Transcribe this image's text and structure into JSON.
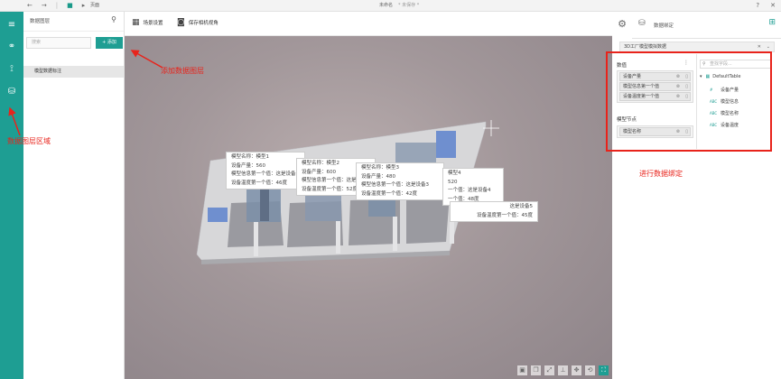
{
  "titlebar": {
    "crumb": "页面",
    "title": "未命名",
    "subtitle": "* 未保存 *",
    "icons": [
      "back-icon",
      "forward-icon",
      "save-icon",
      "page-icon"
    ],
    "help": "?",
    "close": "✕"
  },
  "rail": {
    "items": [
      "menu-icon",
      "link-icon",
      "data-flow-icon",
      "data-layer-icon"
    ]
  },
  "layer_panel": {
    "title": "数据图层",
    "search_placeholder": "搜索",
    "add_label": "+ 添加",
    "items": [
      {
        "label": "模型数据标注"
      }
    ]
  },
  "toolbar": {
    "scene_settings": "场景设置",
    "save_view": "保存相机视角"
  },
  "tooltips": [
    {
      "lines": [
        "模型名称：模型1",
        "设备产量：560",
        "模型信息第一个值：这是设备1",
        "设备温度第一个值：46度"
      ]
    },
    {
      "lines": [
        "模型名称：模型2",
        "设备产量：600",
        "模型信息第一个值：这是设备2",
        "设备温度第一个值：52度"
      ]
    },
    {
      "lines": [
        "模型名称：模型3",
        "设备产量：480",
        "模型信息第一个值：这是设备3",
        "设备温度第一个值：42度"
      ]
    },
    {
      "lines": [
        "模型4",
        "520",
        "一个值：这是设备4",
        "一个值：48度"
      ]
    },
    {
      "lines": [
        "这是设备5",
        "设备温度第一个值：45度"
      ]
    }
  ],
  "right_panel": {
    "tab_title": "数据绑定",
    "source_select": "3D工厂模型模拟数据",
    "data_section": "数值",
    "data_fields": [
      "设备产量",
      "模型信息第一个值",
      "设备温度第一个值"
    ],
    "node_section": "模型节点",
    "node_fields": [
      "模型名称"
    ],
    "field_search_placeholder": "查找字段...",
    "table_name": "DefaultTable",
    "fields": [
      {
        "type": "#",
        "name": "设备产量"
      },
      {
        "type": "ABC",
        "name": "模型信息"
      },
      {
        "type": "ABC",
        "name": "模型名称"
      },
      {
        "type": "ABC",
        "name": "设备温度"
      }
    ]
  },
  "annotations": {
    "add_layer": "添加数据图层",
    "layer_area": "数据图层区域",
    "bind": "进行数据绑定"
  },
  "colors": {
    "accent": "#1e9e93",
    "annotation": "#e8231b"
  }
}
